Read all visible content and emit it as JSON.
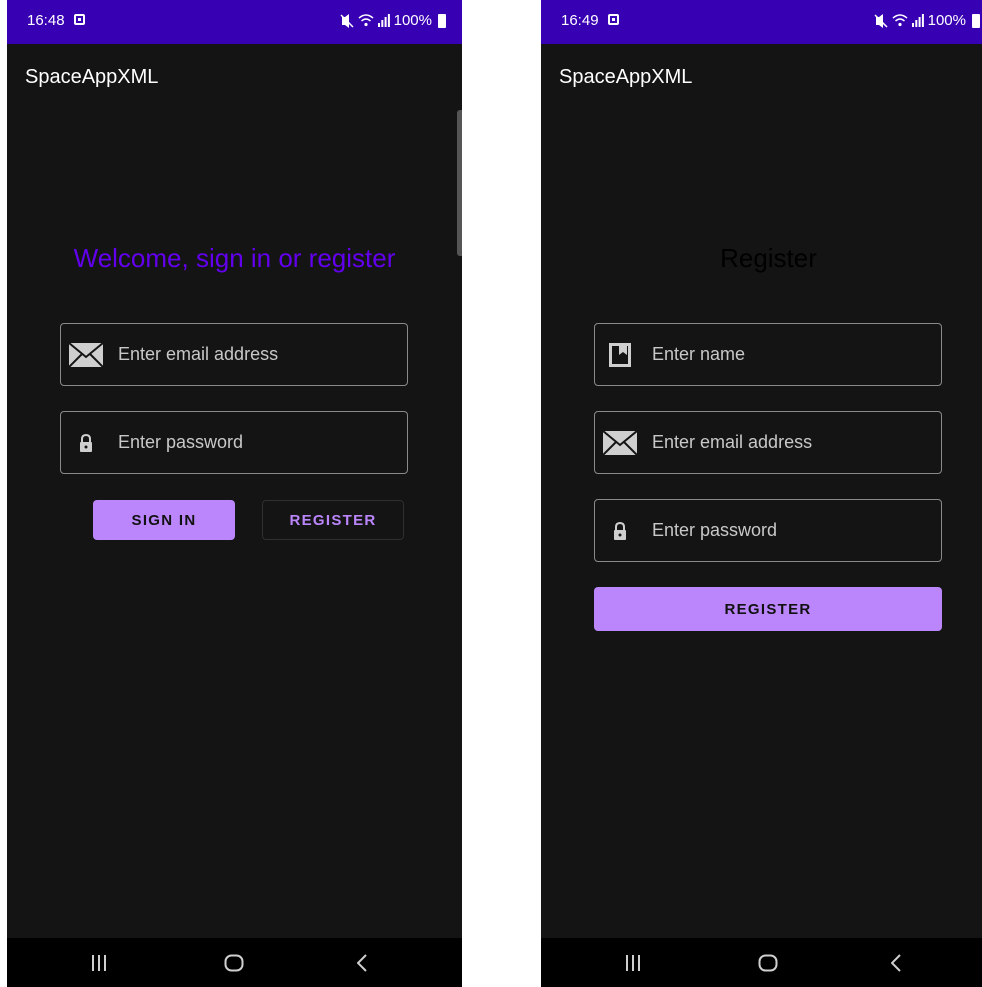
{
  "app": {
    "title": "SpaceAppXML"
  },
  "colors": {
    "status_bar": "#3700b3",
    "accent_primary": "#6200ee",
    "accent_button": "#bb86fc",
    "background": "#141414"
  },
  "screens": {
    "sign_in": {
      "status": {
        "time": "16:48",
        "battery": "100%"
      },
      "heading": "Welcome, sign in or register",
      "fields": {
        "email_placeholder": "Enter email address",
        "password_placeholder": "Enter password"
      },
      "buttons": {
        "sign_in": "SIGN IN",
        "register": "REGISTER"
      }
    },
    "register": {
      "status": {
        "time": "16:49",
        "battery": "100%"
      },
      "heading": "Register",
      "fields": {
        "name_placeholder": "Enter name",
        "email_placeholder": "Enter email address",
        "password_placeholder": "Enter password"
      },
      "buttons": {
        "register": "REGISTER"
      }
    }
  },
  "icons": {
    "mute": "mute-icon",
    "wifi": "wifi-icon",
    "signal": "signal-icon",
    "battery": "battery-icon",
    "email": "envelope-icon",
    "password": "lock-icon",
    "name": "contact-card-icon",
    "nav_recents": "recents-icon",
    "nav_home": "home-icon",
    "nav_back": "back-icon"
  }
}
